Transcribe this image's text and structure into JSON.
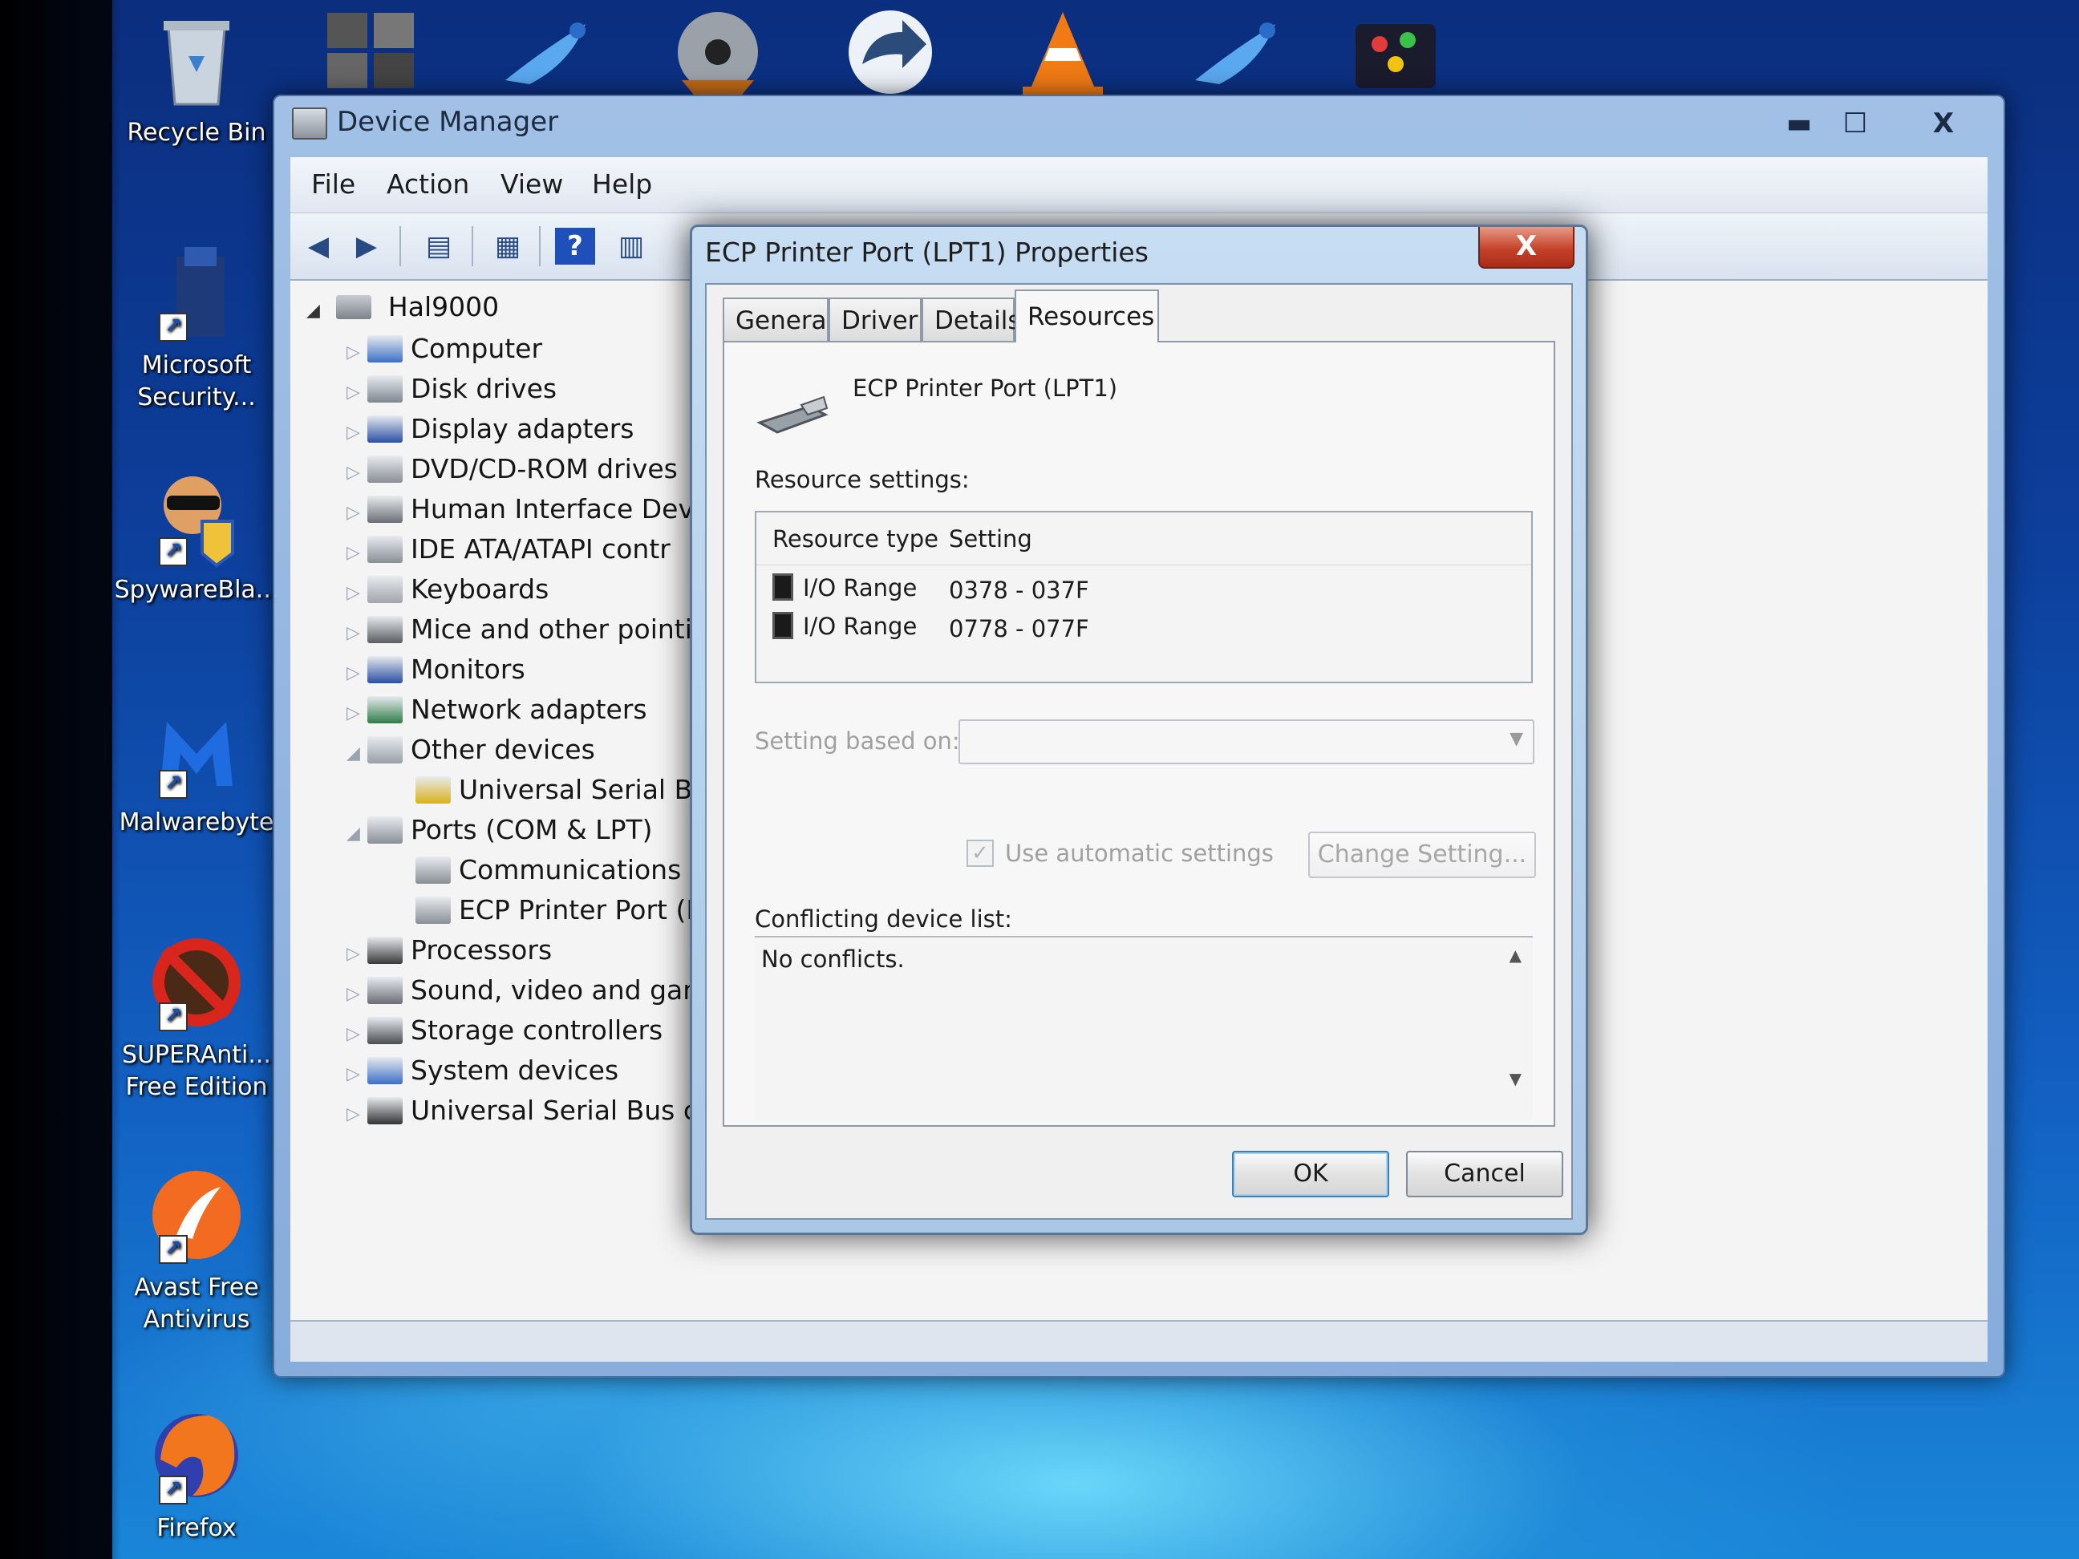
{
  "desktop": {
    "icons": [
      {
        "label": "Recycle Bin",
        "icon": "recycle-bin-icon"
      },
      {
        "label": "Microsoft\nSecurity...",
        "icon": "microsoft-security-icon"
      },
      {
        "label": "SpywareBla...",
        "icon": "spywareblaster-icon"
      },
      {
        "label": "Malwarebyte",
        "icon": "malwarebytes-icon"
      },
      {
        "label": "SUPERAnti...\nFree Edition",
        "icon": "superantispyware-icon"
      },
      {
        "label": "Avast Free\nAntivirus",
        "icon": "avast-icon"
      },
      {
        "label": "Firefox",
        "icon": "firefox-icon"
      }
    ]
  },
  "device_manager": {
    "title": "Device Manager",
    "menu": [
      "File",
      "Action",
      "View",
      "Help"
    ],
    "window_buttons": {
      "minimize": "▬",
      "maximize": "☐",
      "close": "X"
    },
    "tree": {
      "root": "Hal9000",
      "items": [
        {
          "label": "Computer",
          "expander": "▷",
          "icon": "computer-icon",
          "color": "#3c6fc6"
        },
        {
          "label": "Disk drives",
          "expander": "▷",
          "icon": "disk-drive-icon",
          "color": "#7d8792"
        },
        {
          "label": "Display adapters",
          "expander": "▷",
          "icon": "display-adapter-icon",
          "color": "#2b4fa5"
        },
        {
          "label": "DVD/CD-ROM drives",
          "expander": "▷",
          "icon": "dvd-drive-icon",
          "color": "#8a8f96"
        },
        {
          "label": "Human Interface Devi",
          "expander": "▷",
          "icon": "hid-icon",
          "color": "#6b6f75"
        },
        {
          "label": "IDE ATA/ATAPI contr",
          "expander": "▷",
          "icon": "ide-controller-icon",
          "color": "#8a8f96"
        },
        {
          "label": "Keyboards",
          "expander": "▷",
          "icon": "keyboard-icon",
          "color": "#a0a5ab"
        },
        {
          "label": "Mice and other pointi",
          "expander": "▷",
          "icon": "mouse-icon",
          "color": "#5a5d61"
        },
        {
          "label": "Monitors",
          "expander": "▷",
          "icon": "monitor-icon",
          "color": "#2b4fa5"
        },
        {
          "label": "Network adapters",
          "expander": "▷",
          "icon": "network-adapter-icon",
          "color": "#2f7d4a"
        },
        {
          "label": "Other devices",
          "expander": "◢",
          "icon": "other-devices-icon",
          "color": "#9aa0a7"
        },
        {
          "label": "Universal Serial Bu",
          "expander": "",
          "icon": "warning-device-icon",
          "color": "#d9b21c",
          "child": true
        },
        {
          "label": "Ports (COM & LPT)",
          "expander": "◢",
          "icon": "port-icon",
          "color": "#8a8f96"
        },
        {
          "label": "Communications",
          "expander": "",
          "icon": "port-icon",
          "color": "#8a8f96",
          "child": true
        },
        {
          "label": "ECP Printer Port (L",
          "expander": "",
          "icon": "port-icon",
          "color": "#8a8f96",
          "child": true
        },
        {
          "label": "Processors",
          "expander": "▷",
          "icon": "processor-icon",
          "color": "#3a3a3a"
        },
        {
          "label": "Sound, video and gan",
          "expander": "▷",
          "icon": "speaker-icon",
          "color": "#6a6e74"
        },
        {
          "label": "Storage controllers",
          "expander": "▷",
          "icon": "storage-controller-icon",
          "color": "#4a4d52"
        },
        {
          "label": "System devices",
          "expander": "▷",
          "icon": "system-device-icon",
          "color": "#3c6fc6"
        },
        {
          "label": "Universal Serial Bus cc",
          "expander": "▷",
          "icon": "usb-icon",
          "color": "#333"
        }
      ]
    }
  },
  "dialog": {
    "title": "ECP Printer Port (LPT1) Properties",
    "close_label": "X",
    "tabs": [
      "General",
      "Driver",
      "Details",
      "Resources"
    ],
    "active_tab": "Resources",
    "device_name": "ECP Printer Port (LPT1)",
    "resource_settings_label": "Resource settings:",
    "columns": [
      "Resource type",
      "Setting"
    ],
    "resources": [
      {
        "type": "I/O Range",
        "setting": "0378 - 037F"
      },
      {
        "type": "I/O Range",
        "setting": "0778 - 077F"
      }
    ],
    "setting_based_on_label": "Setting based on:",
    "setting_based_on_value": "",
    "use_automatic_label": "Use automatic settings",
    "use_automatic_checked": true,
    "change_setting_label": "Change Setting...",
    "conflicting_label": "Conflicting device list:",
    "conflicts_text": "No conflicts.",
    "ok_label": "OK",
    "cancel_label": "Cancel"
  }
}
